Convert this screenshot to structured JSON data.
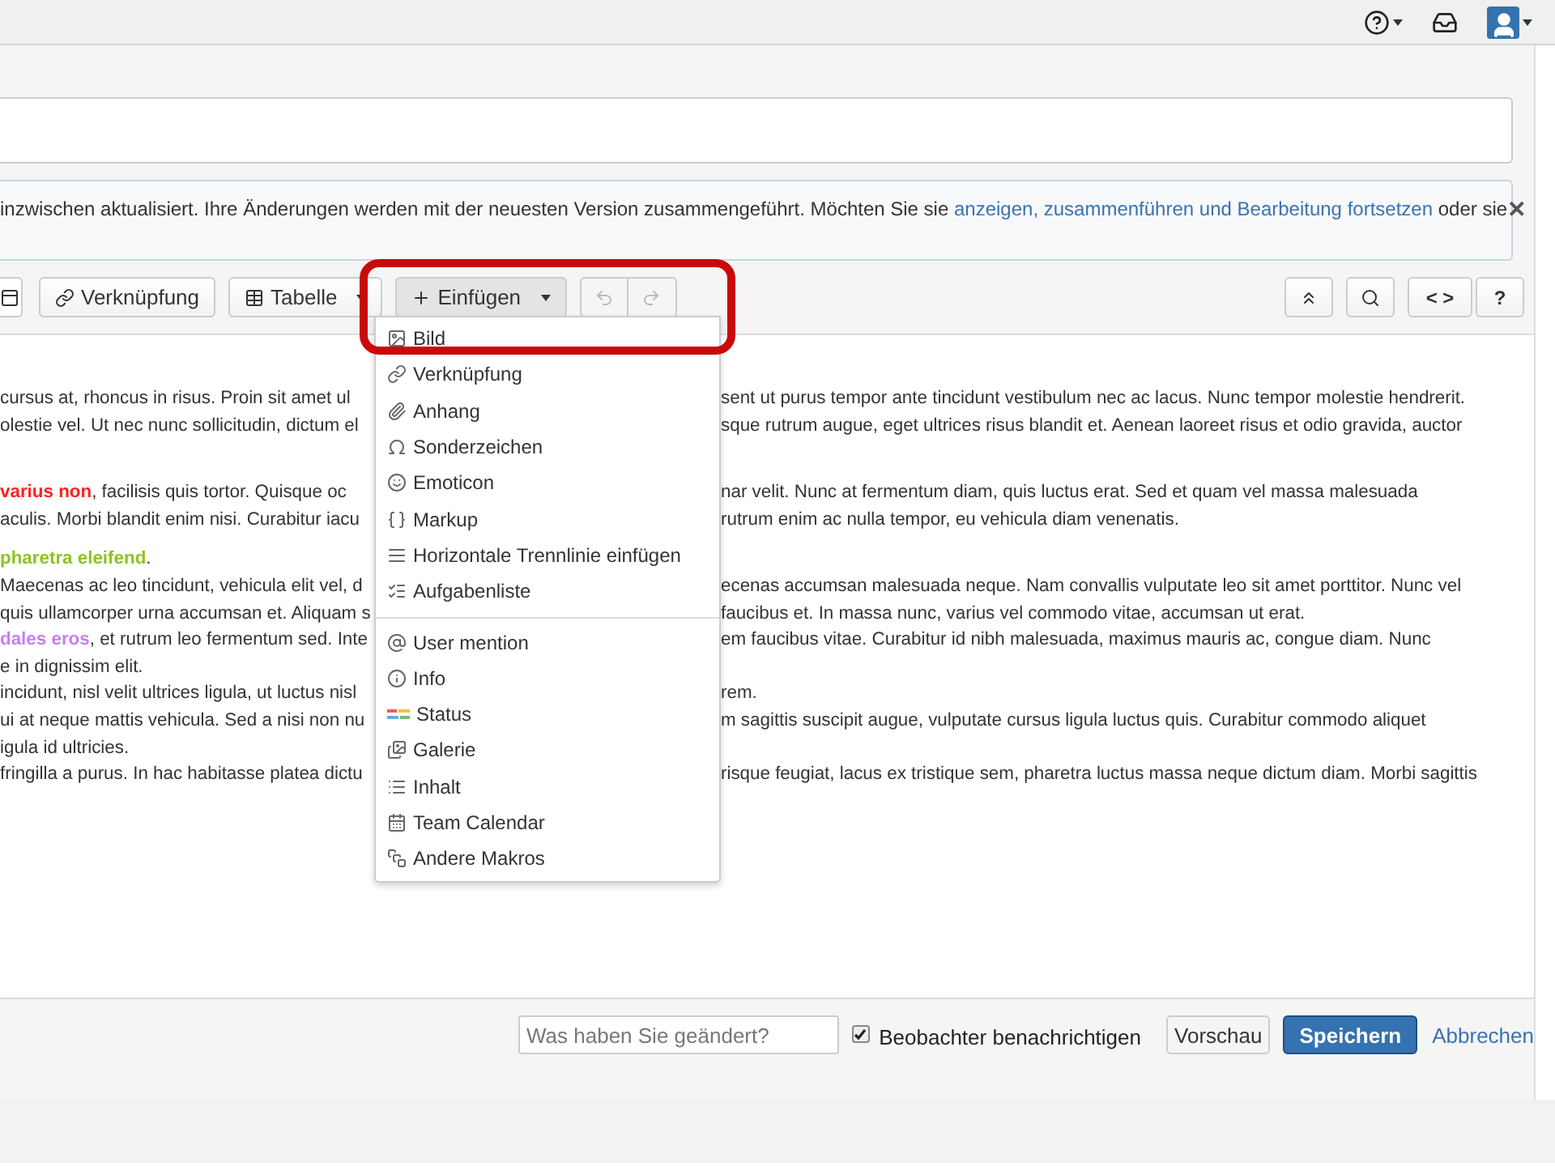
{
  "notice": {
    "text": "inzwischen aktualisiert. Ihre Änderungen werden mit der neuesten Version zusammengeführt. Möchten Sie sie ",
    "link": "anzeigen, zusammenführen und Bearbeitung fortsetzen",
    "after": " oder sie",
    "close": "✕"
  },
  "toolbar": {
    "left": [
      {
        "kind": "icon"
      },
      {
        "kind": "button",
        "label": "Verknüpfung",
        "caret": false,
        "expanded": false
      },
      {
        "kind": "button",
        "label": "Tabelle",
        "caret": true,
        "expanded": false
      },
      {
        "kind": "button",
        "label": "Einfügen",
        "caret": true,
        "expanded": true
      }
    ],
    "history": [
      {
        "disabled": true
      },
      {
        "disabled": true
      }
    ],
    "right": [
      {
        "kind": "icon"
      },
      {
        "kind": "icon"
      },
      {
        "kind": "text",
        "label": "< >"
      },
      {
        "kind": "text",
        "label": "?"
      }
    ]
  },
  "menu": {
    "groups": [
      [
        {
          "label": "Bild"
        },
        {
          "label": "Verknüpfung"
        },
        {
          "label": "Anhang"
        },
        {
          "label": "Sonderzeichen"
        },
        {
          "label": "Emoticon"
        },
        {
          "label": "Markup"
        },
        {
          "label": "Horizontale Trennlinie einfügen"
        },
        {
          "label": "Aufgabenliste"
        }
      ],
      [
        {
          "label": "User mention"
        },
        {
          "label": "Info"
        },
        {
          "label": "Status"
        },
        {
          "label": "Galerie"
        },
        {
          "label": "Inhalt"
        },
        {
          "label": "Team Calendar"
        },
        {
          "label": "Andere Makros"
        }
      ]
    ]
  },
  "body": {
    "paragraphs": [
      {
        "lines": [
          {
            "left": [
              {
                "text": "cursus at, rhoncus in risus. Proin sit amet ul"
              }
            ],
            "right": "sent ut purus tempor ante tincidunt vestibulum nec ac lacus. Nunc tempor molestie hendrerit."
          },
          {
            "left": [
              {
                "text": "olestie vel. Ut nec nunc sollicitudin, dictum el"
              }
            ],
            "right": "sque rutrum augue, eget ultrices risus blandit et. Aenean laoreet risus et odio gravida, auctor"
          }
        ]
      },
      {
        "lines": [
          {
            "left": [
              {
                "text": "varius non",
                "color": "#ff2020"
              },
              {
                "text": ", facilisis quis tortor. Quisque oc"
              }
            ],
            "right": "nar velit. Nunc at fermentum diam, quis luctus erat. Sed et quam vel massa malesuada"
          },
          {
            "left": [
              {
                "text": "aculis. Morbi blandit enim nisi. Curabitur iacu"
              }
            ],
            "right": "rutrum enim ac nulla tempor, eu vehicula diam venenatis."
          }
        ]
      },
      {
        "lines": [
          {
            "left": [
              {
                "text": "pharetra eleifend",
                "color": "#8fc31f"
              },
              {
                "text": "."
              }
            ]
          },
          {
            "left": [
              {
                "text": "Maecenas ac leo tincidunt, vehicula elit vel, d"
              }
            ],
            "right": "ecenas accumsan malesuada neque. Nam convallis vulputate leo sit amet porttitor. Nunc vel"
          },
          {
            "left": [
              {
                "text": "quis ullamcorper urna accumsan et. Aliquam s"
              }
            ],
            "right": "faucibus et. In massa nunc, varius vel commodo vitae, accumsan ut erat."
          },
          {
            "left": [
              {
                "text": "dales eros",
                "color": "#c77ff0"
              },
              {
                "text": ", et rutrum leo fermentum sed. Inte"
              }
            ],
            "right": "em faucibus vitae. Curabitur id nibh malesuada, maximus mauris ac, congue diam. Nunc"
          },
          {
            "left": [
              {
                "text": "e in dignissim elit."
              }
            ]
          },
          {
            "left": [
              {
                "text": "incidunt, nisl velit ultrices ligula, ut luctus nisl"
              }
            ],
            "right": "rem."
          },
          {
            "left": [
              {
                "text": "ui at neque mattis vehicula. Sed a nisi non nu"
              }
            ],
            "right": "m sagittis suscipit augue, vulputate cursus ligula luctus quis. Curabitur commodo aliquet"
          },
          {
            "left": [
              {
                "text": "igula id ultricies."
              }
            ]
          },
          {
            "left": [
              {
                "text": "fringilla a purus. In hac habitasse platea dictu"
              }
            ],
            "right": "risque feugiat, lacus ex tristique sem, pharetra luctus massa neque dictum diam. Morbi sagittis"
          }
        ]
      }
    ]
  },
  "footer": {
    "comment": {
      "placeholder": "Was haben Sie geändert?"
    },
    "notify": {
      "label": "Beobachter benachrichtigen",
      "checked": true
    },
    "preview": "Vorschau",
    "save": "Speichern",
    "cancel": "Abbrechen"
  }
}
